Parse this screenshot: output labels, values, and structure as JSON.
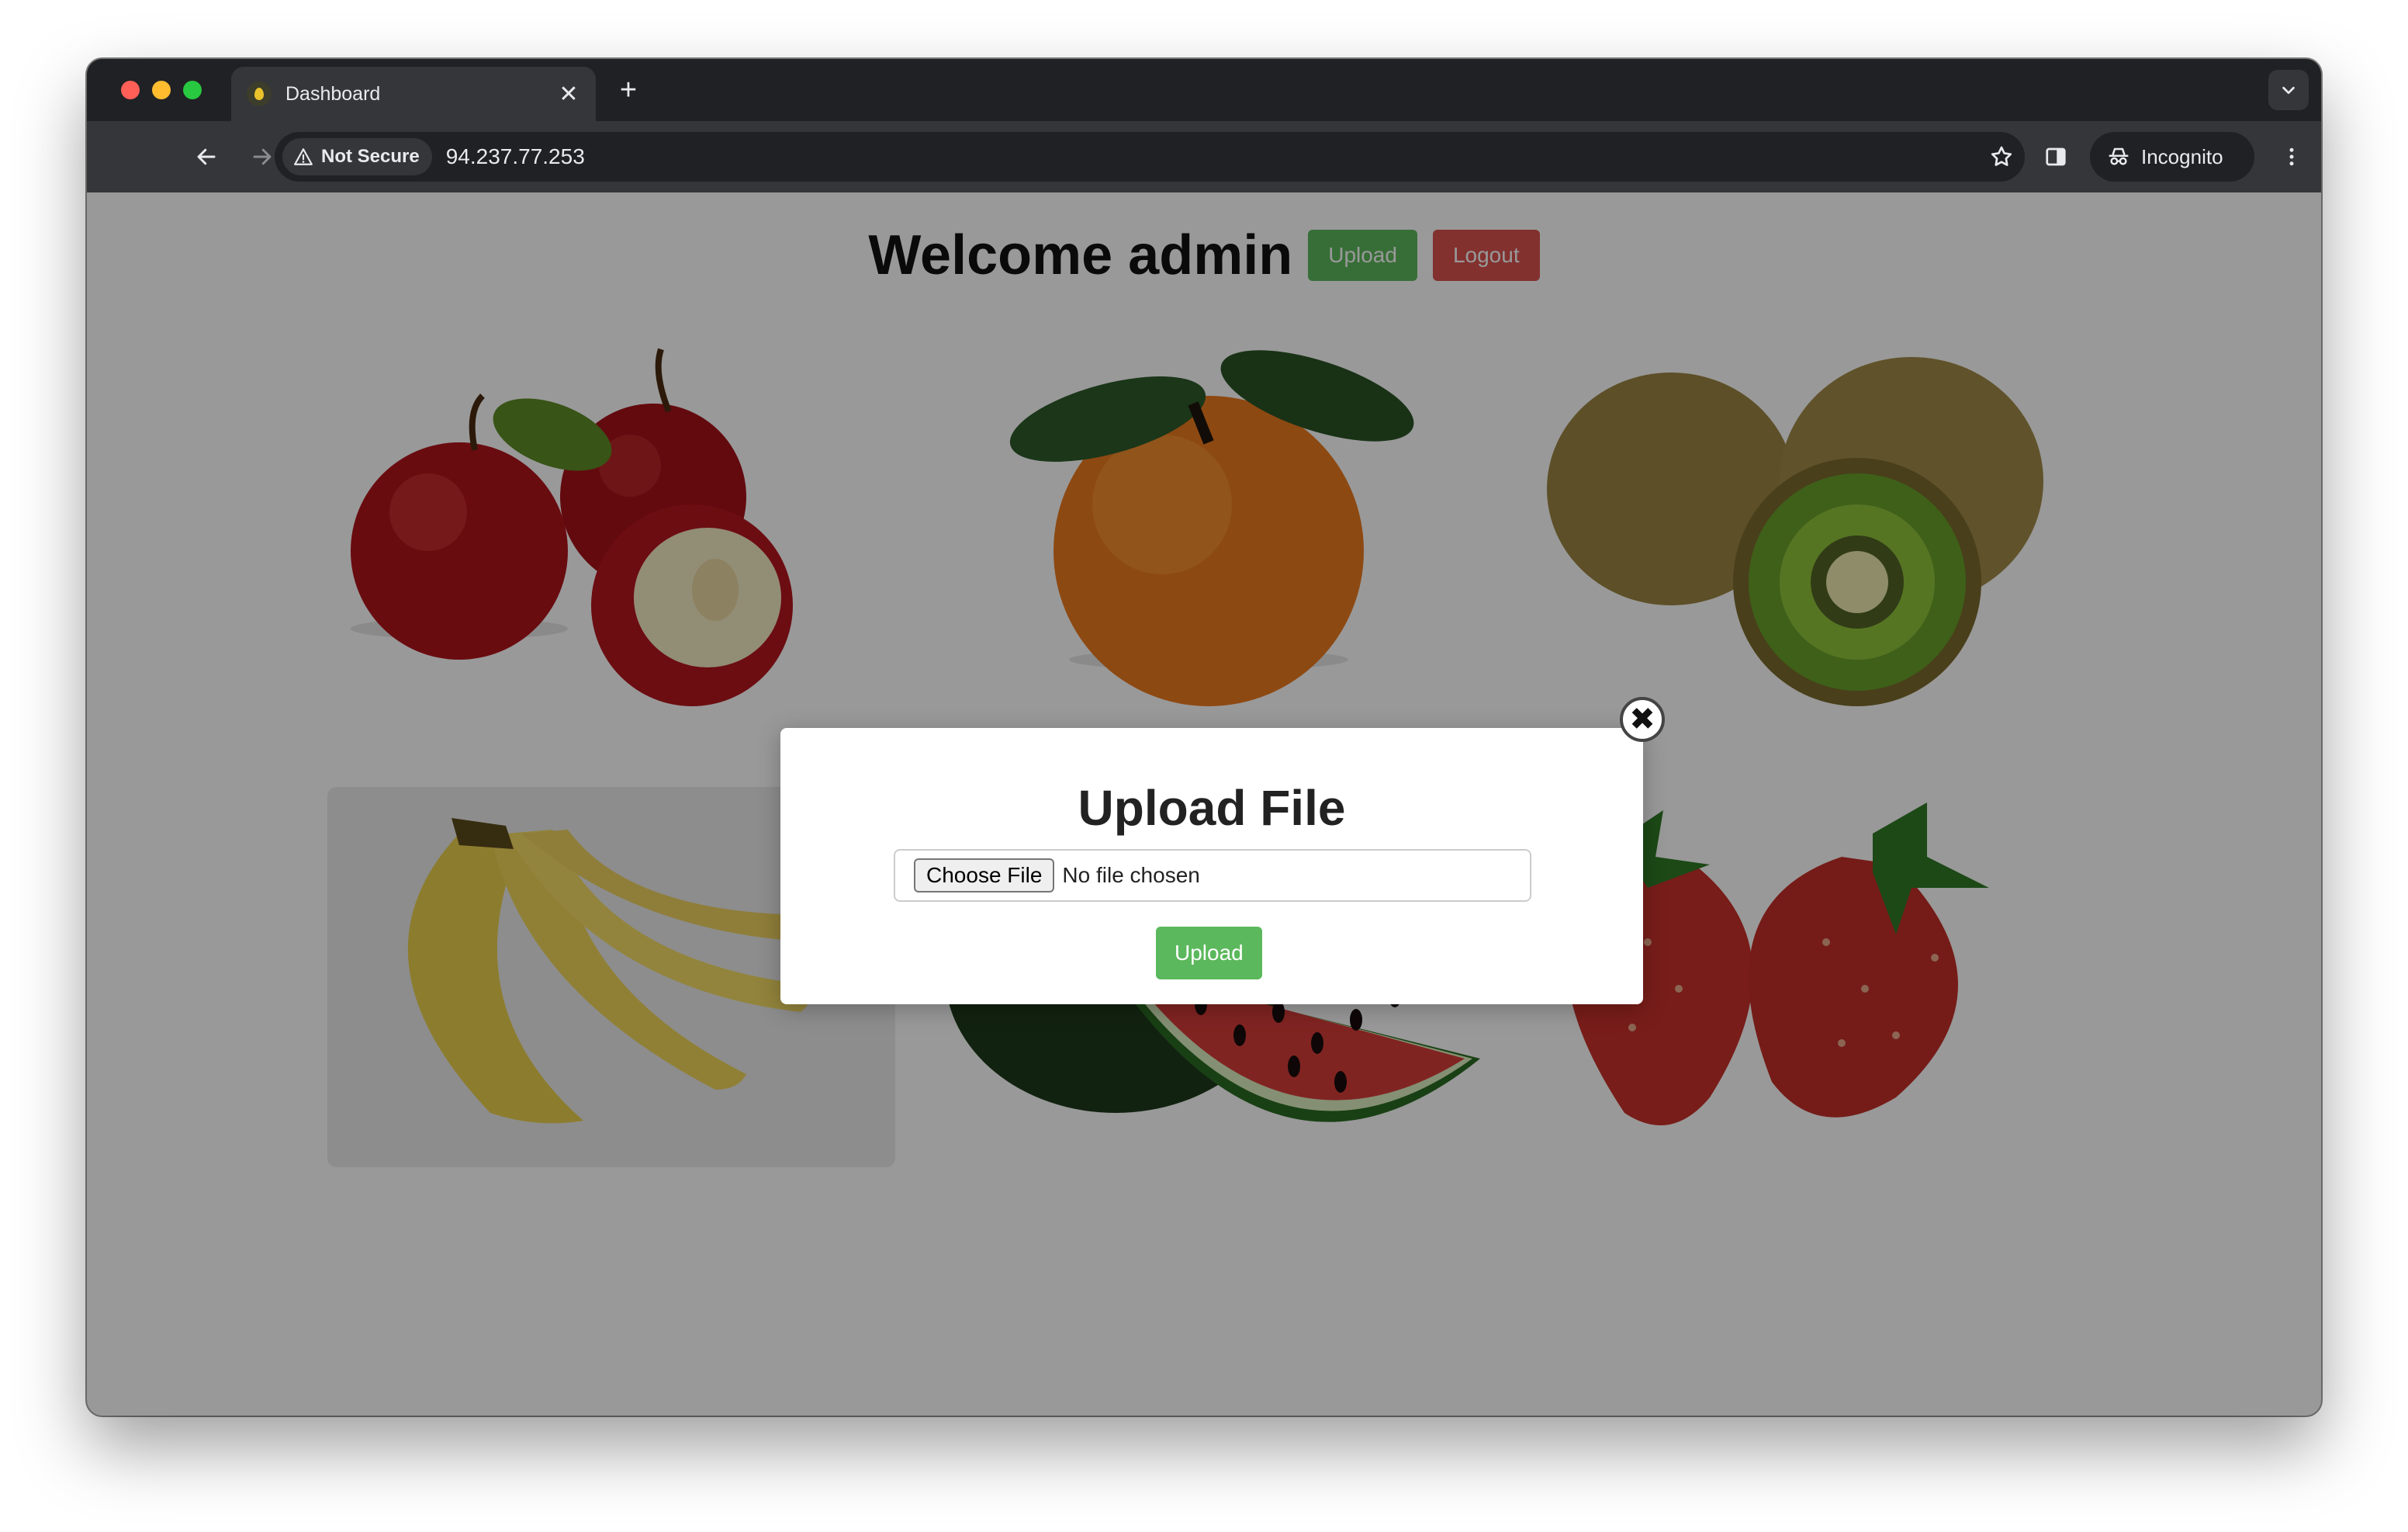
{
  "browser": {
    "tab": {
      "title": "Dashboard",
      "close_glyph": "✕"
    },
    "new_tab_glyph": "+",
    "security_label": "Not Secure",
    "url": "94.237.77.253",
    "profile_label": "Incognito"
  },
  "page": {
    "welcome_text": "Welcome admin",
    "upload_label": "Upload",
    "logout_label": "Logout",
    "fruit_cards": [
      "apples",
      "orange",
      "kiwi",
      "bananas",
      "watermelon",
      "strawberries"
    ]
  },
  "modal": {
    "title": "Upload File",
    "choose_file_label": "Choose File",
    "no_file_text": "No file chosen",
    "upload_label": "Upload",
    "close_glyph": "✖"
  },
  "colors": {
    "success": "#5cb85c",
    "danger": "#d9534f",
    "overlay": "rgba(0,0,0,0.4)"
  },
  "icons": [
    "back-arrow-icon",
    "forward-arrow-icon",
    "reload-icon",
    "warning-triangle-icon",
    "star-icon",
    "side-panel-icon",
    "incognito-icon",
    "kebab-menu-icon",
    "chevron-down-icon",
    "close-icon"
  ]
}
